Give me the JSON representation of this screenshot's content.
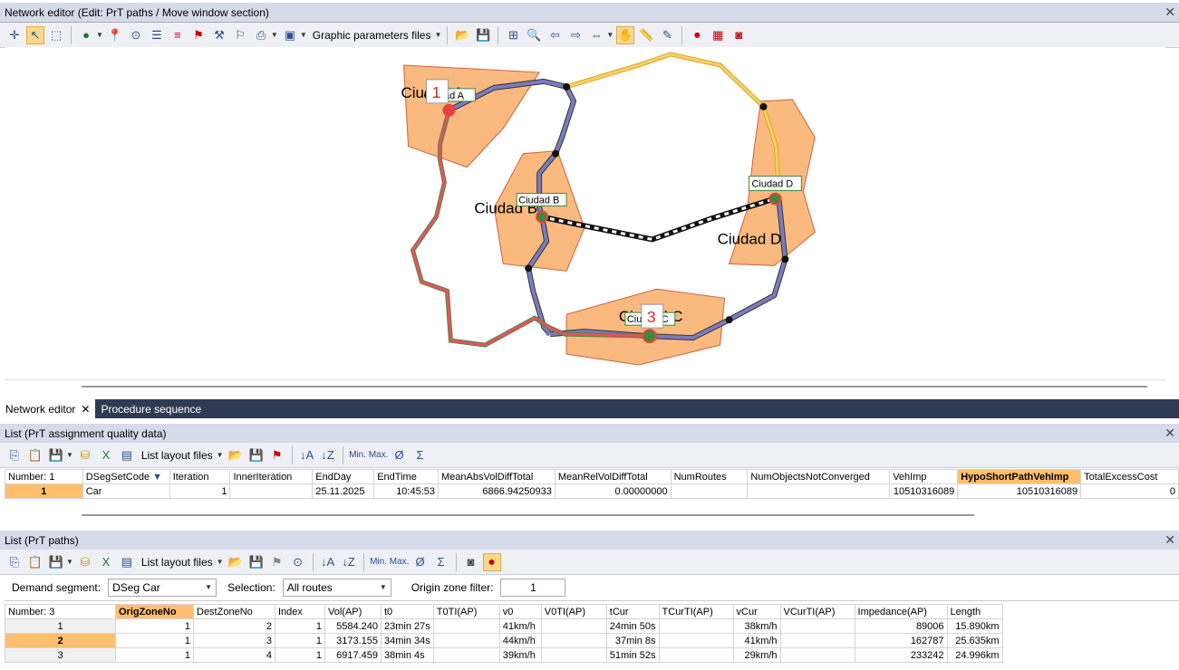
{
  "window": {
    "title": "Network editor (Edit: PrT paths / Move window section)"
  },
  "toolbar1": {
    "graphic_params_label": "Graphic parameters files"
  },
  "map": {
    "zone_labels": [
      "Ciudad A",
      "Ciudad B",
      "Ciudad C",
      "Ciudad D"
    ],
    "node_tags": {
      "a": "Ciudad A",
      "b": "Ciudad B",
      "c": "Ciudad C",
      "d": "Ciudad D"
    },
    "markers": {
      "origin": "1",
      "dest": "3"
    }
  },
  "tabs": [
    {
      "label": "Network editor",
      "close": "✕"
    },
    {
      "label": "Procedure sequence"
    }
  ],
  "list1": {
    "title": "List (PrT assignment quality data)",
    "layout_label": "List layout files",
    "columns": [
      "Number: 1",
      "DSegSetCode",
      "Iteration",
      "InnerIteration",
      "EndDay",
      "EndTime",
      "MeanAbsVolDiffTotal",
      "MeanRelVolDiffTotal",
      "NumRoutes",
      "NumObjectsNotConverged",
      "VehImp",
      "HypoShortPathVehImp",
      "TotalExcessCost"
    ],
    "row": [
      "1",
      "Car",
      "1",
      "",
      "25.11.2025",
      "10:45:53",
      "6866.94250933",
      "0.00000000",
      "",
      "",
      "10510316089",
      "10510316089",
      "0"
    ]
  },
  "list2": {
    "title": "List (PrT paths)",
    "layout_label": "List layout files",
    "demand_label": "Demand segment:",
    "demand_value": "DSeg Car",
    "selection_label": "Selection:",
    "selection_value": "All routes",
    "origin_label": "Origin zone filter:",
    "origin_value": "1",
    "columns": [
      "Number: 3",
      "OrigZoneNo",
      "DestZoneNo",
      "Index",
      "Vol(AP)",
      "t0",
      "T0TI(AP)",
      "v0",
      "V0TI(AP)",
      "tCur",
      "TCurTI(AP)",
      "vCur",
      "VCurTI(AP)",
      "Impedance(AP)",
      "Length"
    ],
    "rows": [
      [
        "1",
        "1",
        "2",
        "1",
        "5584.240",
        "23min 27s",
        "",
        "41km/h",
        "",
        "24min 50s",
        "",
        "38km/h",
        "",
        "89006",
        "15.890km"
      ],
      [
        "2",
        "1",
        "3",
        "1",
        "3173.155",
        "34min 34s",
        "",
        "44km/h",
        "",
        "37min 8s",
        "",
        "41km/h",
        "",
        "162787",
        "25.635km"
      ],
      [
        "3",
        "1",
        "4",
        "1",
        "6917.459",
        "38min 4s",
        "",
        "39km/h",
        "",
        "51min 52s",
        "",
        "29km/h",
        "",
        "233242",
        "24.996km"
      ]
    ]
  },
  "colors": {
    "zone_fill": "#f9b97f",
    "link": "#7b7bbf",
    "route": "#e8525a",
    "rail": "#222",
    "yellow": "#f0c040",
    "accent": "#ffbf6e"
  }
}
